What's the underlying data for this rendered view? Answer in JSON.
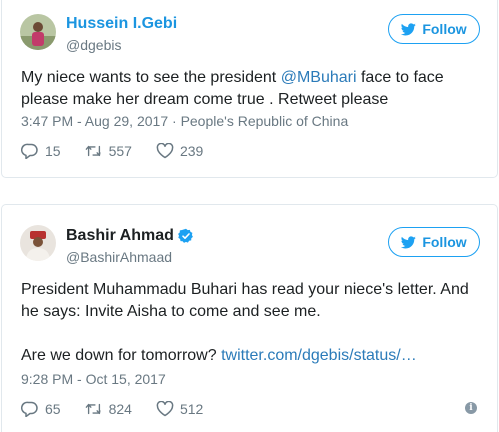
{
  "tweets": [
    {
      "author": {
        "name": "Hussein I.Gebi",
        "handle": "@dgebis",
        "verified": false
      },
      "follow_label": "Follow",
      "text": {
        "before_mention": "My niece wants to see the president ",
        "mention": "@MBuhari",
        "after_mention": " face to face please make her dream come true . Retweet please"
      },
      "timestamp": "3:47 PM - Aug 29, 2017",
      "separator": "·",
      "location": "People's Republic of China",
      "replies": "15",
      "retweets": "557",
      "likes": "239"
    },
    {
      "author": {
        "name": "Bashir Ahmad",
        "handle": "@BashirAhmaad",
        "verified": true
      },
      "follow_label": "Follow",
      "text": {
        "line1": "President Muhammadu Buhari has read your niece's letter. And he says: Invite Aisha to come and see me.",
        "line2_prefix": "Are we down for tomorrow? ",
        "link": "twitter.com/dgebis/status/…"
      },
      "timestamp": "9:28 PM - Oct 15, 2017",
      "replies": "65",
      "retweets": "824",
      "likes": "512"
    }
  ],
  "icons": {
    "follow": "twitter-bird-icon",
    "reply": "reply-icon",
    "retweet": "retweet-icon",
    "like": "heart-icon",
    "verified": "verified-badge-icon",
    "info": "info-icon"
  },
  "colors": {
    "link_blue": "#1b95e0",
    "mention_blue": "#2b7bb9",
    "meta_gray": "#697882",
    "border": "#e1e8ed",
    "verified": "#1da1f2"
  }
}
